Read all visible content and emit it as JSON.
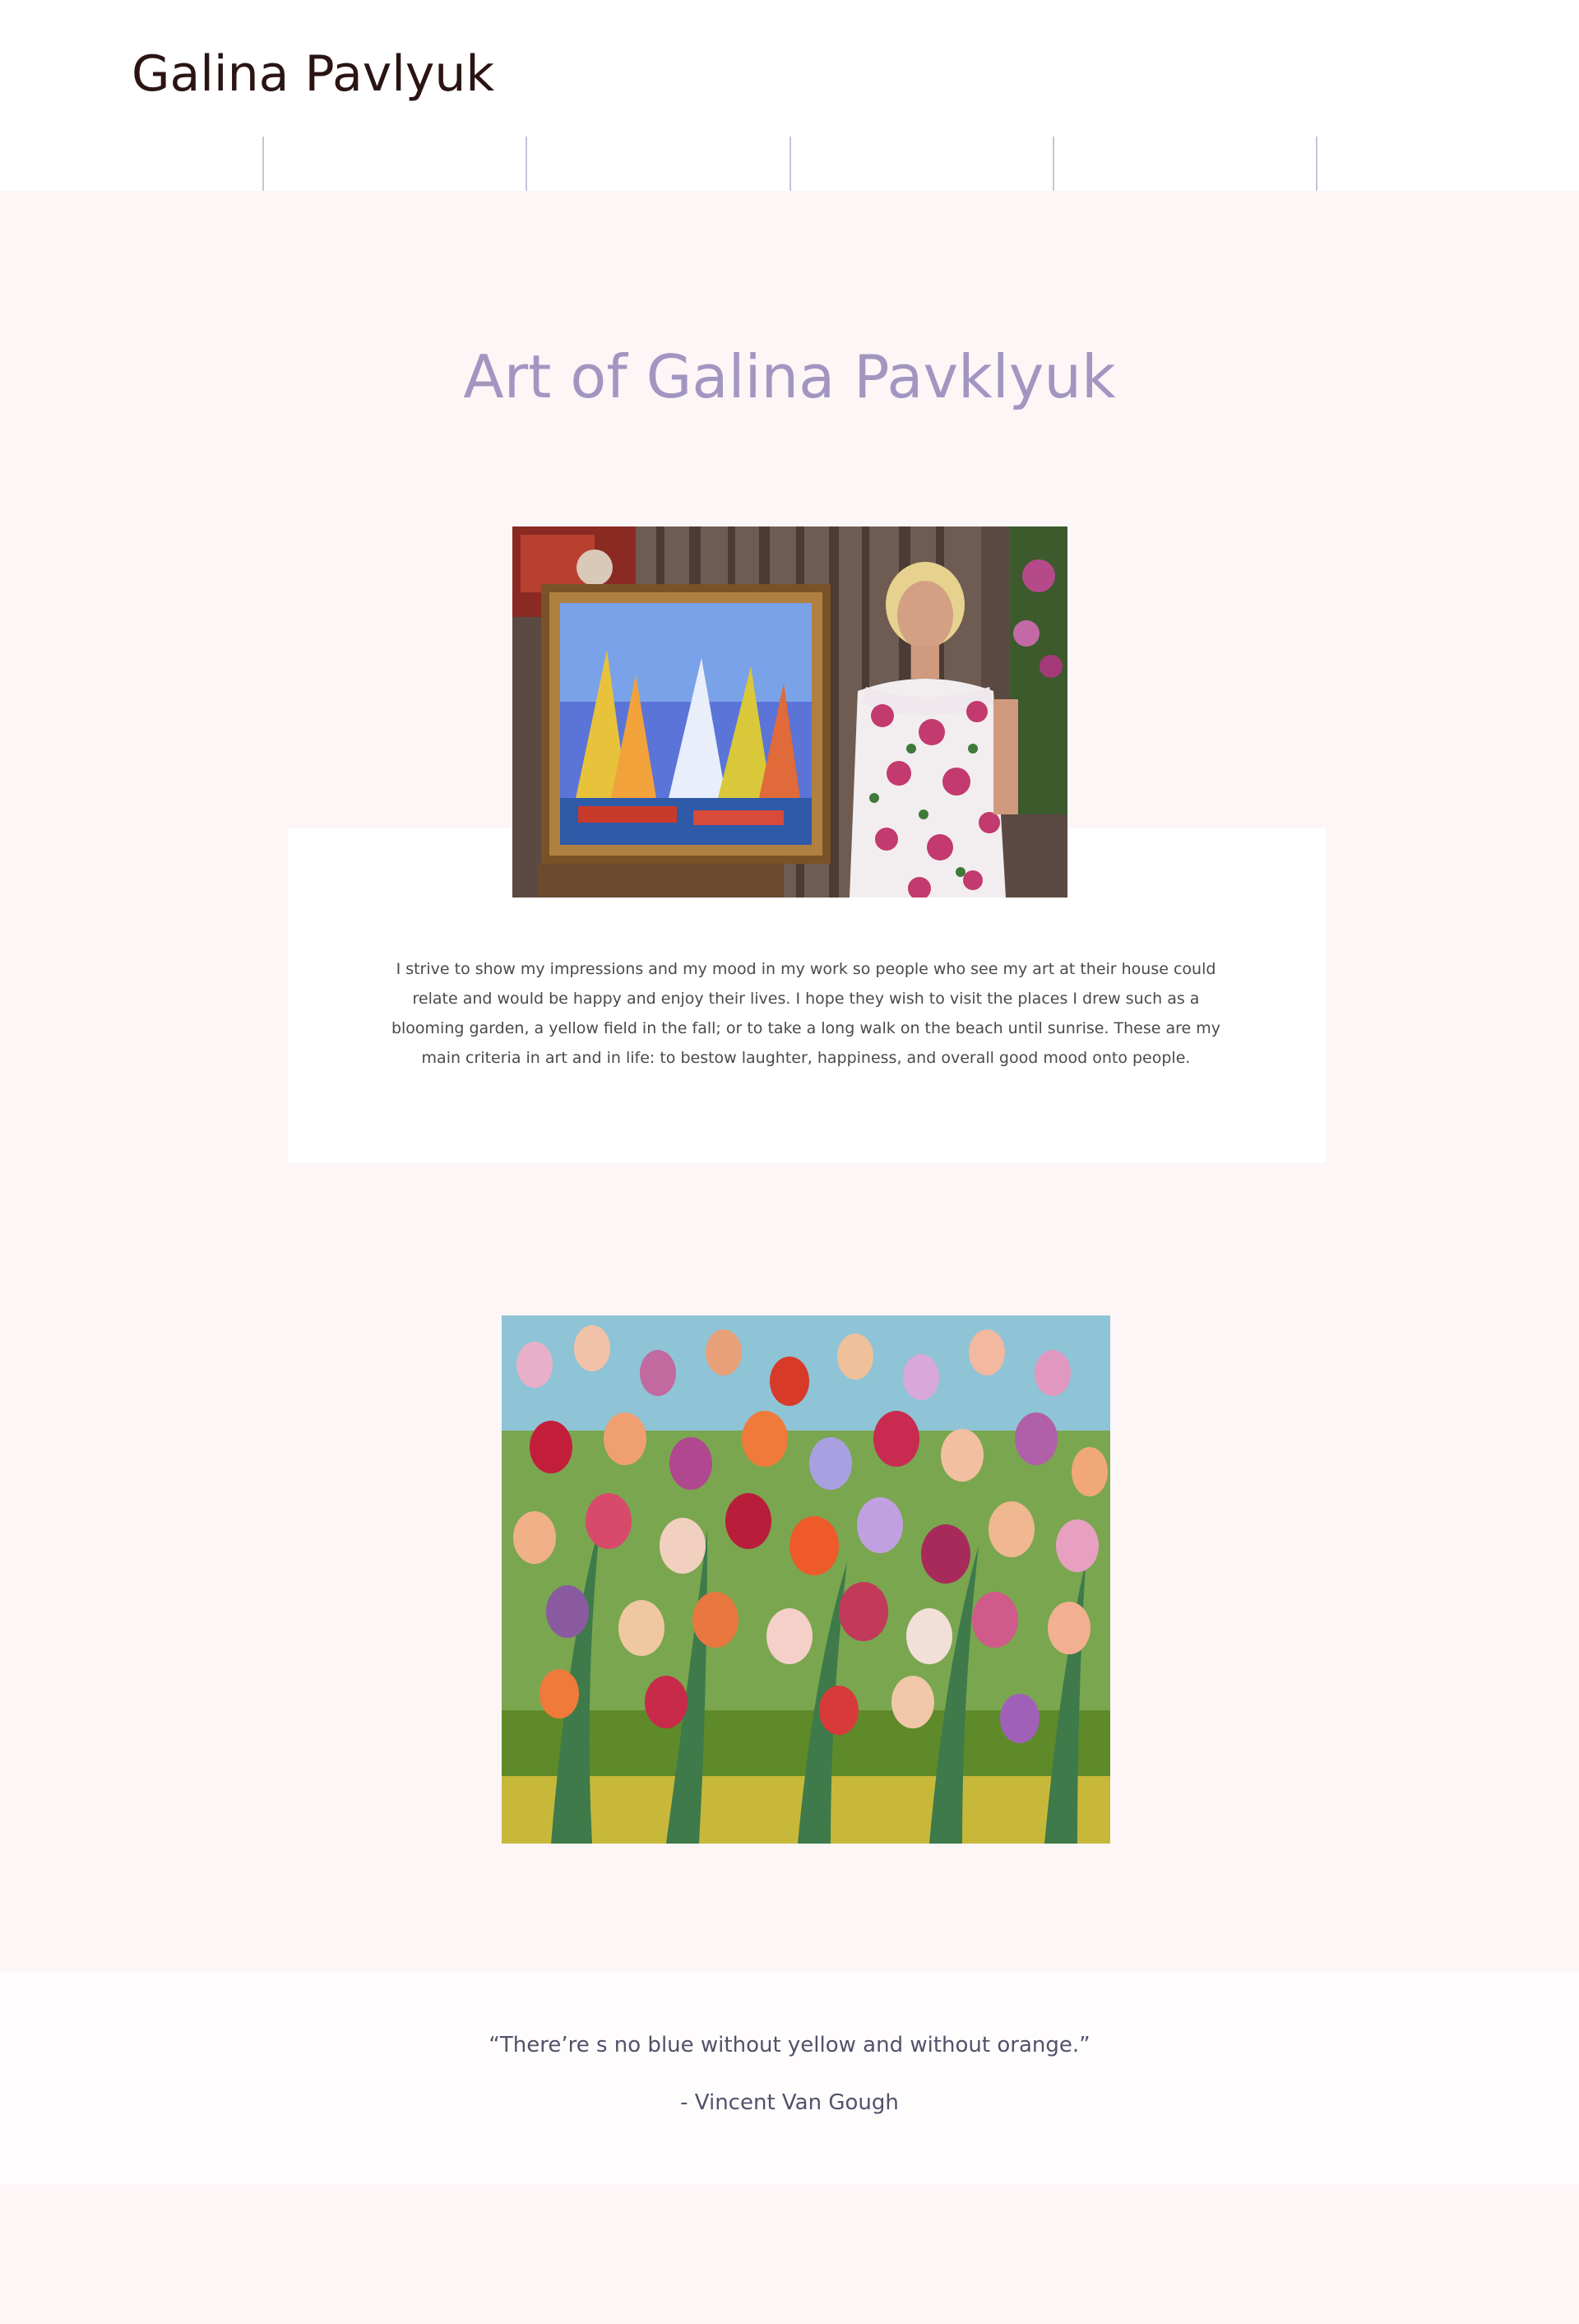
{
  "header": {
    "site_title": "Galina Pavlyuk",
    "nav": {
      "items": [
        "",
        "",
        "",
        "",
        "",
        ""
      ],
      "divider_color": "#c9c4da"
    }
  },
  "hero": {
    "title": "Art of Galina Pavklyuk",
    "title_color": "#a296c1"
  },
  "about": {
    "photo_alt": "Artist standing next to a framed painting of sailboats",
    "text": "I strive to show my impressions and my mood in my work so people who see my art at their house could relate and would be happy and enjoy their lives. I hope they wish to visit the places I drew such as a blooming garden, a yellow field in the fall; or to take a long walk on the beach until sunrise. These are my main criteria in art and in life: to bestow laughter, happiness, and overall good mood onto people."
  },
  "gallery": {
    "painting_alt": "Painting of a field of colorful tulips"
  },
  "quote": {
    "text": "“There’re s no blue without yellow and without orange.”",
    "author": "- Vincent Van Gough"
  },
  "colors": {
    "page_background": "#fcf6f7",
    "header_background": "#ffffff",
    "title_text": "#2a1414",
    "body_text": "#4a4a4a",
    "quote_text": "#55506a"
  }
}
